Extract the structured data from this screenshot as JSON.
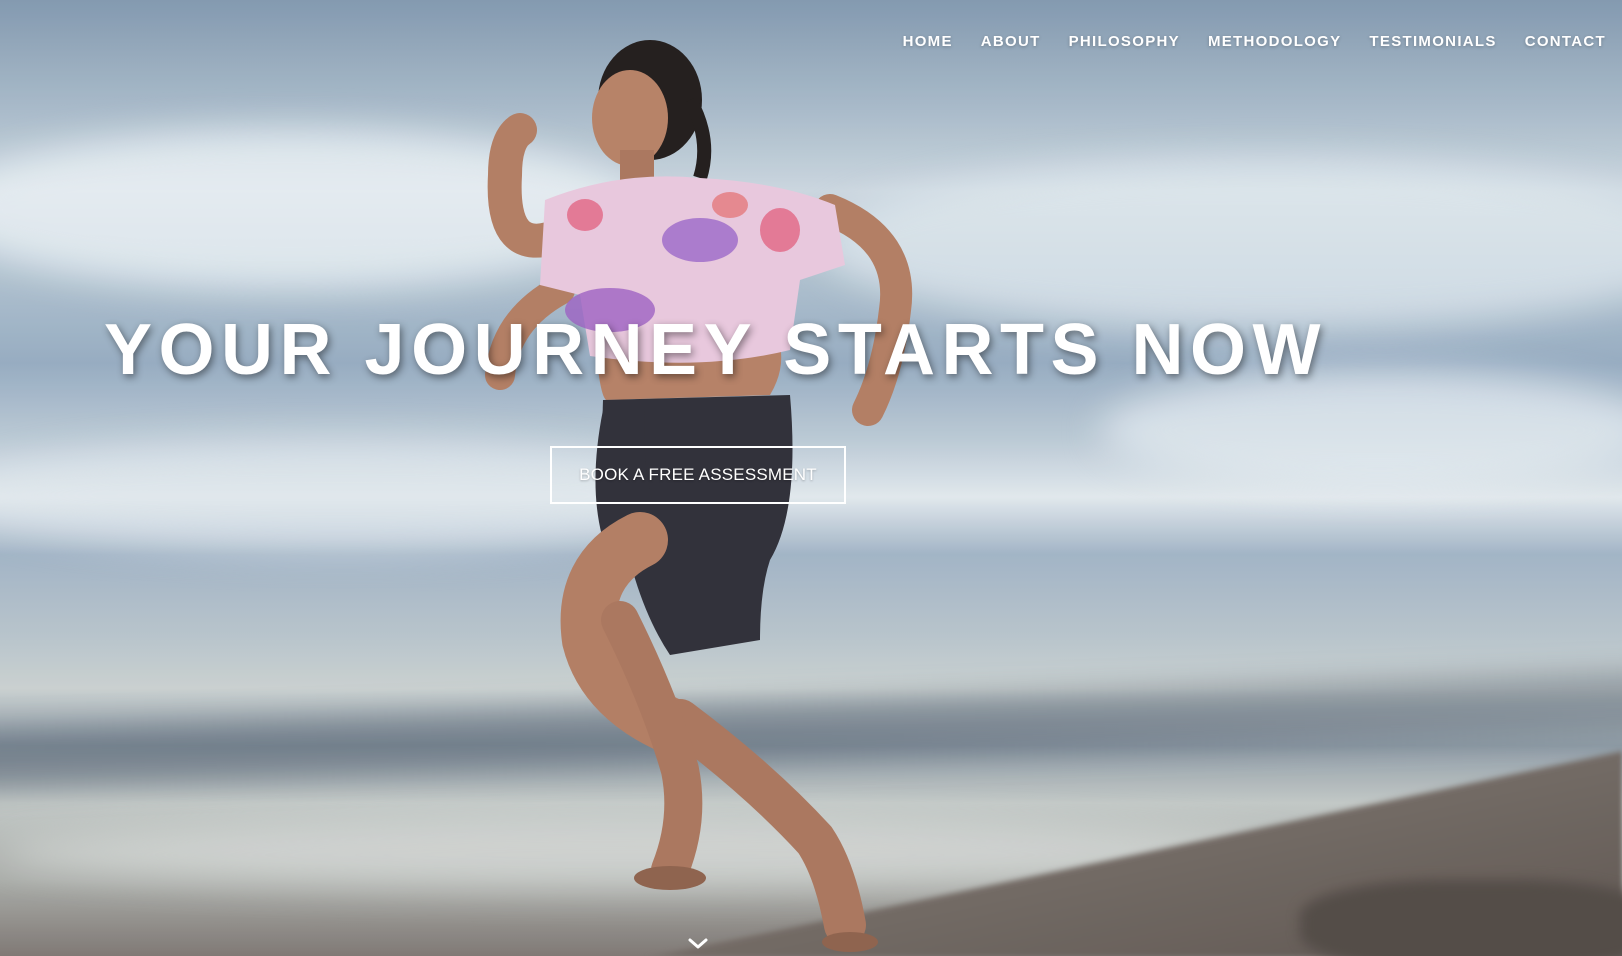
{
  "nav": {
    "items": [
      {
        "label": "HOME"
      },
      {
        "label": "ABOUT"
      },
      {
        "label": "PHILOSOPHY"
      },
      {
        "label": "METHODOLOGY"
      },
      {
        "label": "TESTIMONIALS"
      },
      {
        "label": "CONTACT"
      }
    ]
  },
  "hero": {
    "headline": "YOUR JOURNEY STARTS NOW",
    "cta_label": "BOOK A FREE ASSESSMENT",
    "scroll_icon": "chevron-down-icon",
    "background_image": "woman running on beach in tie-dye crop top and black shorts, ocean waves behind"
  },
  "colors": {
    "text": "#ffffff",
    "cta_border": "#ffffff"
  }
}
